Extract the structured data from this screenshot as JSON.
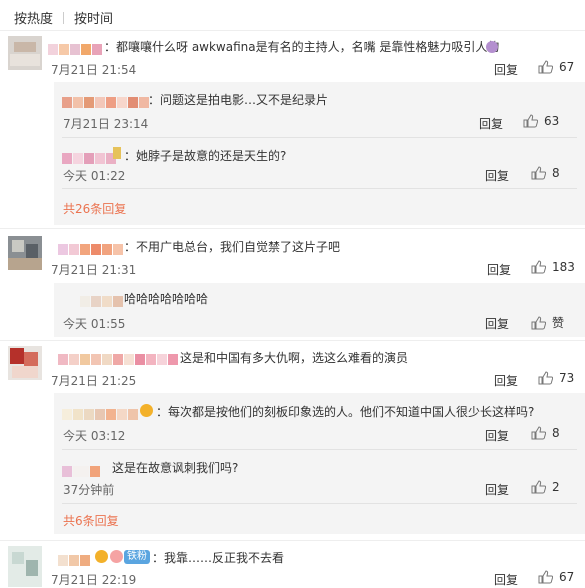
{
  "sort": {
    "hot": "按热度",
    "time": "按时间"
  },
  "reply_label": "回复",
  "like_label_praise": "赞",
  "icons": {
    "like": "thumbs-up-icon"
  },
  "colors": {
    "link": "#eb7350",
    "badge": "#5aa5e0"
  },
  "comments": [
    {
      "text": "：都嚷嚷什么呀 awkwafina是有名的主持人，名嘴 是靠性格魅力吸引人的",
      "time": "7月21日 21:54",
      "likes": "67"
    },
    {
      "text": "：不用广电总台，我们自觉禁了这片子吧",
      "time": "7月21日 21:31",
      "likes": "183"
    },
    {
      "text": "这是和中国有多大仇啊，选这么难看的演员",
      "time": "7月21日 21:25",
      "likes": "73"
    },
    {
      "text": "：我靠……反正我不去看",
      "time": "7月21日 22:19",
      "likes": "67",
      "badge": "铁粉"
    }
  ],
  "replies": [
    {
      "text": "：问题这是拍电影…又不是纪录片",
      "time": "7月21日 23:14",
      "likes": "63"
    },
    {
      "text": "：她脖子是故意的还是天生的?",
      "time": "今天 01:22",
      "likes": "8"
    },
    {
      "text": "哈哈哈哈哈哈哈",
      "time": "今天 01:55"
    },
    {
      "text": "：每次都是按他们的刻板印象选的人。他们不知道中国人很少长这样吗?",
      "time": "今天 03:12",
      "likes": "8"
    },
    {
      "text": "这是在故意讽刺我们吗?",
      "time": "37分钟前",
      "likes": "2"
    }
  ],
  "more": [
    "共26条回复",
    "共6条回复"
  ]
}
